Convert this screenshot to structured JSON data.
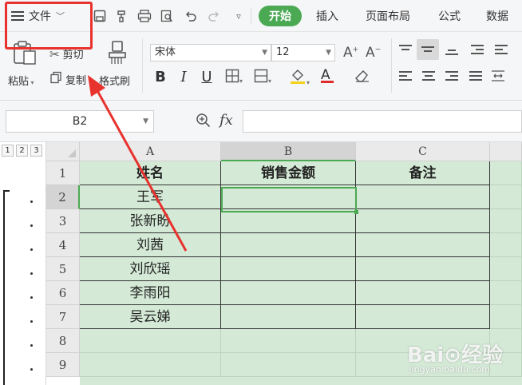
{
  "menu": {
    "file_label": "文件",
    "tabs": [
      {
        "label": "开始",
        "active": true
      },
      {
        "label": "插入"
      },
      {
        "label": "页面布局"
      },
      {
        "label": "公式"
      },
      {
        "label": "数据"
      }
    ],
    "accent_color": "#4ba954",
    "highlight_color": "#e8322d"
  },
  "ribbon": {
    "paste_label": "粘贴",
    "cut_label": "剪切",
    "copy_label": "复制",
    "format_painter_label": "格式刷",
    "font_name": "宋体",
    "font_size": "12",
    "bold": "B",
    "italic": "I",
    "underline": "U"
  },
  "formula_bar": {
    "name_box": "B2",
    "fx": "fx",
    "value": ""
  },
  "sheet": {
    "outline_levels": [
      "1",
      "2",
      "3"
    ],
    "columns": [
      "A",
      "B",
      "C"
    ],
    "selected_column": "B",
    "rows": [
      "1",
      "2",
      "3",
      "4",
      "5",
      "6",
      "7",
      "8",
      "9"
    ],
    "selected_row": "2",
    "headers": [
      "姓名",
      "销售金额",
      "备注"
    ],
    "names": [
      "王军",
      "张新盼",
      "刘茜",
      "刘欣瑶",
      "李雨阳",
      "吴云娣"
    ],
    "active_cell": "B2"
  },
  "watermark": {
    "brand": "Bai⊙经验",
    "url": "jingyan.baidu.com"
  }
}
